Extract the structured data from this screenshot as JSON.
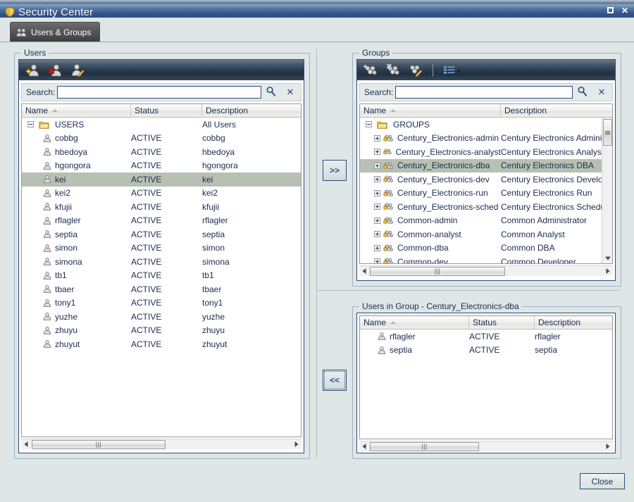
{
  "window": {
    "title": "Security Center",
    "icon": "shield-icon",
    "maximize_label": "□",
    "close_label": "✕"
  },
  "tabs": [
    {
      "label": "Users & Groups",
      "icon": "users-group-icon",
      "active": true
    }
  ],
  "users_panel": {
    "legend": "Users",
    "toolbar": [
      {
        "name": "add-user-icon",
        "title": "Add User"
      },
      {
        "name": "delete-user-icon",
        "title": "Delete User"
      },
      {
        "name": "edit-user-icon",
        "title": "Edit User"
      }
    ],
    "search": {
      "label": "Search:",
      "value": "",
      "placeholder": "",
      "go_icon": "magnifier-icon",
      "clear_icon": "clear-x-icon"
    },
    "columns": [
      "Name",
      "Status",
      "Description"
    ],
    "sort_column": "Name",
    "sort_direction": "ascending",
    "root": {
      "name": "USERS",
      "status": "",
      "description": "All Users",
      "expanded": true
    },
    "rows": [
      {
        "name": "cobbg",
        "status": "ACTIVE",
        "description": "cobbg",
        "selected": false
      },
      {
        "name": "hbedoya",
        "status": "ACTIVE",
        "description": "hbedoya",
        "selected": false
      },
      {
        "name": "hgongora",
        "status": "ACTIVE",
        "description": "hgongora",
        "selected": false
      },
      {
        "name": "kei",
        "status": "ACTIVE",
        "description": "kei",
        "selected": true
      },
      {
        "name": "kei2",
        "status": "ACTIVE",
        "description": "kei2",
        "selected": false
      },
      {
        "name": "kfujii",
        "status": "ACTIVE",
        "description": "kfujii",
        "selected": false
      },
      {
        "name": "rflagler",
        "status": "ACTIVE",
        "description": "rflagler",
        "selected": false
      },
      {
        "name": "septia",
        "status": "ACTIVE",
        "description": "septia",
        "selected": false
      },
      {
        "name": "simon",
        "status": "ACTIVE",
        "description": "simon",
        "selected": false
      },
      {
        "name": "simona",
        "status": "ACTIVE",
        "description": "simona",
        "selected": false
      },
      {
        "name": "tb1",
        "status": "ACTIVE",
        "description": "tb1",
        "selected": false
      },
      {
        "name": "tbaer",
        "status": "ACTIVE",
        "description": "tbaer",
        "selected": false
      },
      {
        "name": "tony1",
        "status": "ACTIVE",
        "description": "tony1",
        "selected": false
      },
      {
        "name": "yuzhe",
        "status": "ACTIVE",
        "description": "yuzhe",
        "selected": false
      },
      {
        "name": "zhuyu",
        "status": "ACTIVE",
        "description": "zhuyu",
        "selected": false
      },
      {
        "name": "zhuyut",
        "status": "ACTIVE",
        "description": "zhuyut",
        "selected": false
      }
    ]
  },
  "groups_panel": {
    "legend": "Groups",
    "toolbar": [
      {
        "name": "add-group-icon",
        "title": "Add Group"
      },
      {
        "name": "delete-group-icon",
        "title": "Delete Group"
      },
      {
        "name": "edit-group-icon",
        "title": "Edit Group"
      },
      {
        "name": "view-list-dropdown-icon",
        "title": "View"
      }
    ],
    "search": {
      "label": "Search:",
      "value": "",
      "placeholder": "",
      "go_icon": "magnifier-icon",
      "clear_icon": "clear-x-icon"
    },
    "columns": [
      "Name",
      "Description"
    ],
    "sort_column": "Name",
    "sort_direction": "ascending",
    "root": {
      "name": "GROUPS",
      "description": "",
      "expanded": true
    },
    "rows": [
      {
        "name": "Century_Electronics-admin",
        "description": "Century Electronics Administrator",
        "selected": false
      },
      {
        "name": "Century_Electronics-analyst",
        "description": "Century Electronics Analyst",
        "selected": false
      },
      {
        "name": "Century_Electronics-dba",
        "description": "Century Electronics DBA",
        "selected": true
      },
      {
        "name": "Century_Electronics-dev",
        "description": "Century Electronics Developer",
        "selected": false
      },
      {
        "name": "Century_Electronics-run",
        "description": "Century Electronics Run",
        "selected": false
      },
      {
        "name": "Century_Electronics-sched",
        "description": "Century Electronics Schedule",
        "selected": false
      },
      {
        "name": "Common-admin",
        "description": "Common Administrator",
        "selected": false
      },
      {
        "name": "Common-analyst",
        "description": "Common Analyst",
        "selected": false
      },
      {
        "name": "Common-dba",
        "description": "Common DBA",
        "selected": false
      },
      {
        "name": "Common-dev",
        "description": "Common Developer",
        "selected": false
      }
    ]
  },
  "users_in_group_panel": {
    "legend": "Users in Group - Century_Electronics-dba",
    "columns": [
      "Name",
      "Status",
      "Description"
    ],
    "sort_column": "Name",
    "sort_direction": "ascending",
    "rows": [
      {
        "name": "rflagler",
        "status": "ACTIVE",
        "description": "rflagler"
      },
      {
        "name": "septia",
        "status": "ACTIVE",
        "description": "septia"
      }
    ]
  },
  "transfer": {
    "add_label": ">>",
    "remove_label": "<<"
  },
  "footer": {
    "close_label": "Close"
  },
  "colors": {
    "titlebar_accent": "#2c4d84",
    "selection": "#b7c0b2",
    "panel_border": "#2e4a7d",
    "background": "#dfe6e6",
    "tab_active": "#4b4b4b"
  }
}
